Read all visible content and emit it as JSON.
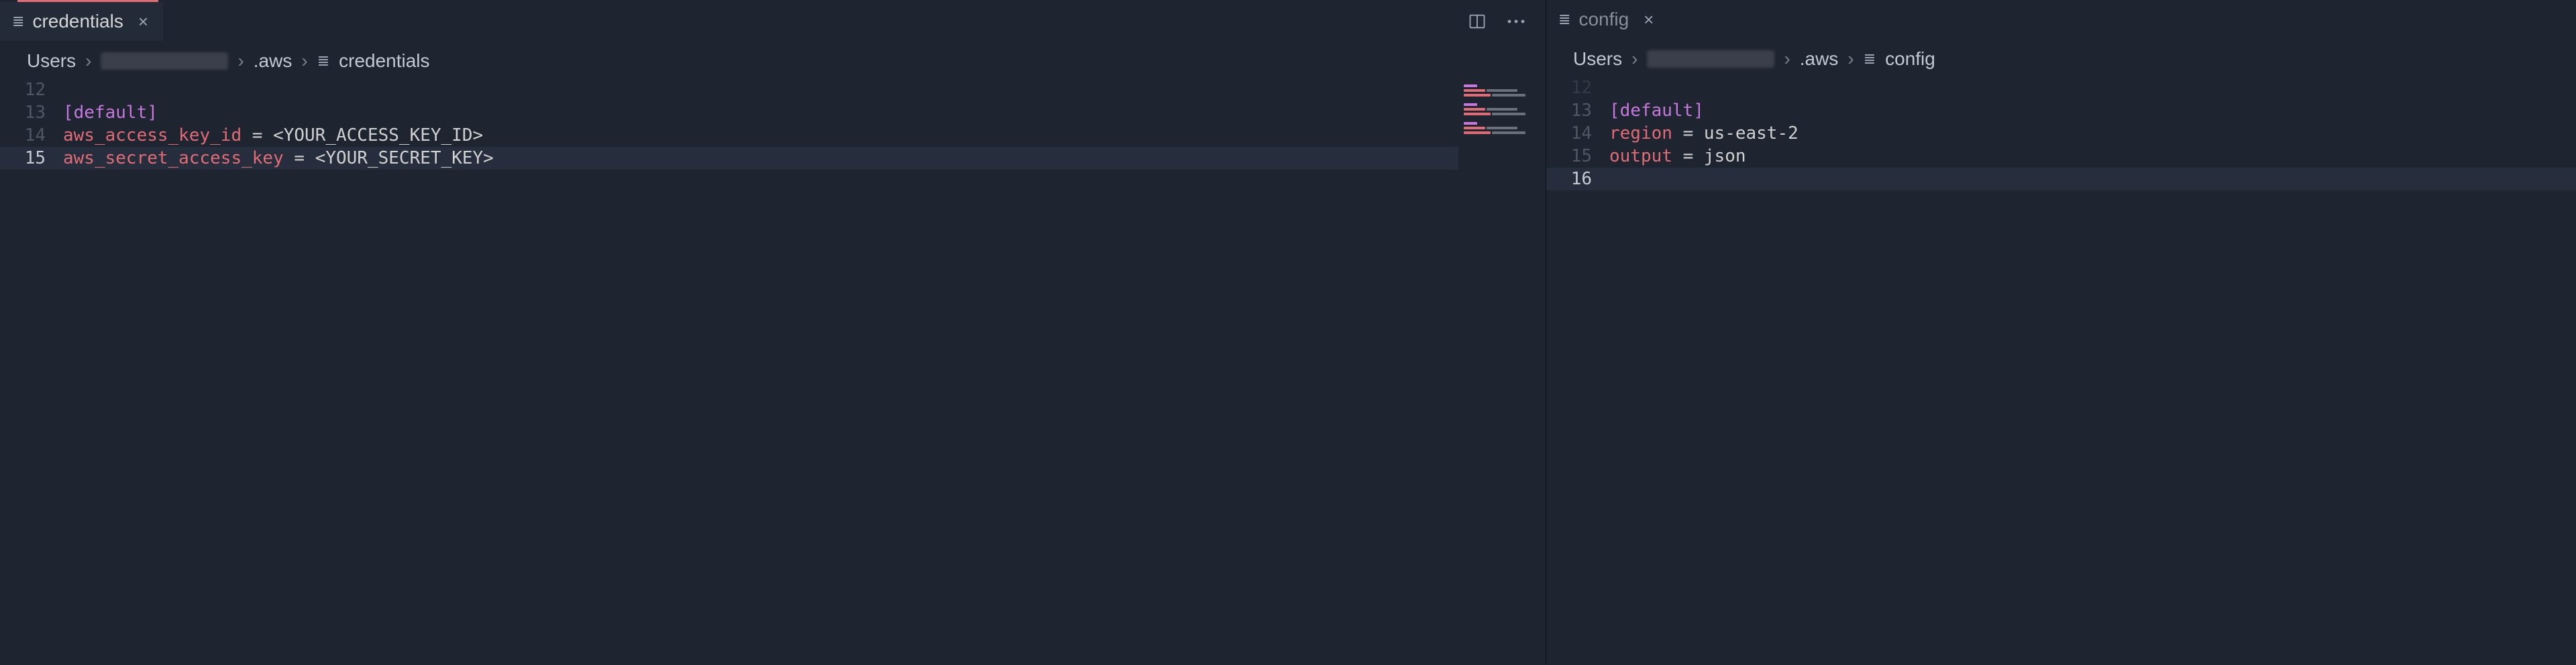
{
  "left": {
    "tab": {
      "label": "credentials"
    },
    "breadcrumbs": [
      "Users",
      "[redacted]",
      ".aws",
      "credentials"
    ],
    "lines": [
      {
        "n": 12,
        "tokens": []
      },
      {
        "n": 13,
        "tokens": [
          {
            "cls": "tk-section",
            "t": "[default]"
          }
        ]
      },
      {
        "n": 14,
        "tokens": [
          {
            "cls": "tk-key",
            "t": "aws_access_key_id"
          },
          {
            "cls": "tk-eq",
            "t": " = "
          },
          {
            "cls": "tk-val",
            "t": "<YOUR_ACCESS_KEY_ID>"
          }
        ]
      },
      {
        "n": 15,
        "active": true,
        "tokens": [
          {
            "cls": "tk-key",
            "t": "aws_secret_access_key"
          },
          {
            "cls": "tk-eq",
            "t": " = "
          },
          {
            "cls": "tk-val",
            "t": "<YOUR_SECRET_KEY>"
          }
        ]
      }
    ]
  },
  "right": {
    "tab": {
      "label": "config"
    },
    "breadcrumbs": [
      "Users",
      "[redacted]",
      ".aws",
      "config"
    ],
    "lines": [
      {
        "n": 12,
        "dim": true,
        "tokens": []
      },
      {
        "n": 13,
        "tokens": [
          {
            "cls": "tk-section",
            "t": "[default]"
          }
        ]
      },
      {
        "n": 14,
        "tokens": [
          {
            "cls": "tk-key",
            "t": "region"
          },
          {
            "cls": "tk-eq",
            "t": " = "
          },
          {
            "cls": "tk-val",
            "t": "us-east-2"
          }
        ]
      },
      {
        "n": 15,
        "tokens": [
          {
            "cls": "tk-key",
            "t": "output"
          },
          {
            "cls": "tk-eq",
            "t": " = "
          },
          {
            "cls": "tk-val",
            "t": "json"
          }
        ]
      },
      {
        "n": 16,
        "active": true,
        "tokens": []
      }
    ]
  },
  "icons": {
    "file_glyph": "≣"
  }
}
